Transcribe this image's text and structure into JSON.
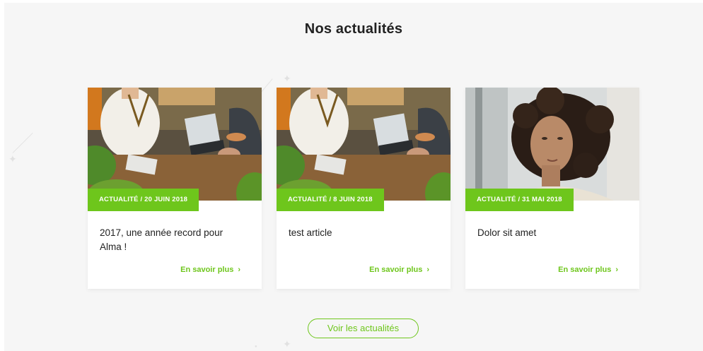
{
  "section": {
    "title": "Nos actualités",
    "accent_color": "#6ec61c"
  },
  "cards": [
    {
      "badge": "Actualité / 20 juin 2018",
      "title": "2017, une année record pour Alma !",
      "link": "En savoir plus",
      "image": "office-meeting-laptop-photo"
    },
    {
      "badge": "Actualité / 8 juin 2018",
      "title": "test article",
      "link": "En savoir plus",
      "image": "office-meeting-laptop-photo"
    },
    {
      "badge": "Actualité / 31 mai 2018",
      "title": "Dolor sit amet",
      "link": "En savoir plus",
      "image": "woman-curly-hair-portrait-photo"
    }
  ],
  "cta": {
    "label": "Voir les actualités"
  },
  "icons": {
    "chevron": "chevron-right-icon",
    "decoration": "sparkle-icon"
  }
}
